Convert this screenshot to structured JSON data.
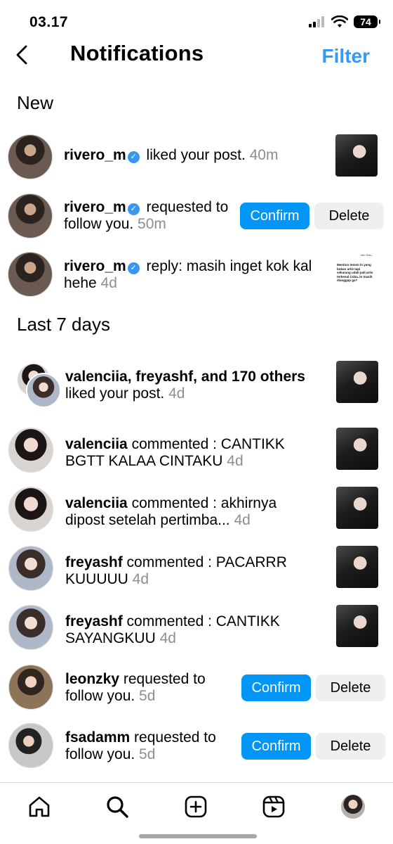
{
  "status_bar": {
    "time": "03.17",
    "battery": "74"
  },
  "header": {
    "title": "Notifications",
    "filter": "Filter"
  },
  "sections": {
    "new": "New",
    "last7": "Last 7 days"
  },
  "notifications": [
    {
      "user": "rivero_m",
      "text": " liked your post.",
      "time": " 40m"
    },
    {
      "user": "rivero_m",
      "text": " requested to follow you.",
      "time": " 50m",
      "confirm": "Confirm",
      "delete": "Delete"
    },
    {
      "user": "rivero_m",
      "text": " reply: masih inget kok kal hehe",
      "time": " 4d"
    },
    {
      "user": "valenciia, freyashf, and 170 others",
      "text": " liked your post.",
      "time": " 4d"
    },
    {
      "user": "valenciia",
      "text": " commented : CANTIKK BGTT KALAA CINTAKU",
      "time": " 4d"
    },
    {
      "user": "valenciia",
      "text": " commented : akhirnya dipost setelah pertimba...",
      "time": " 4d"
    },
    {
      "user": "freyashf",
      "text": " commented : PACARRR KUUUUU",
      "time": " 4d"
    },
    {
      "user": "freyashf",
      "text": " commented : CANTIKK SAYANGKUU",
      "time": " 4d"
    },
    {
      "user": "leonzky",
      "text": " requested to follow you.",
      "time": " 5d",
      "confirm": "Confirm",
      "delete": "Delete"
    },
    {
      "user": "fsadamm",
      "text": " requested to follow you.",
      "time": " 5d",
      "confirm": "Confirm",
      "delete": "Delete"
    }
  ],
  "thumbnail_text": {
    "top": "min Sda...",
    "body": "Mention temen lo yang bukan artis tapi sekarang udah jadi artis terkenal Coba..lo masih dianggap ga?"
  },
  "nav": {
    "icons": [
      "home-icon",
      "search-icon",
      "create-icon",
      "reels-icon",
      "profile-avatar"
    ]
  },
  "colors": {
    "accent": "#0095f6",
    "filter": "#3897f0",
    "muted": "#8e8e8e"
  }
}
